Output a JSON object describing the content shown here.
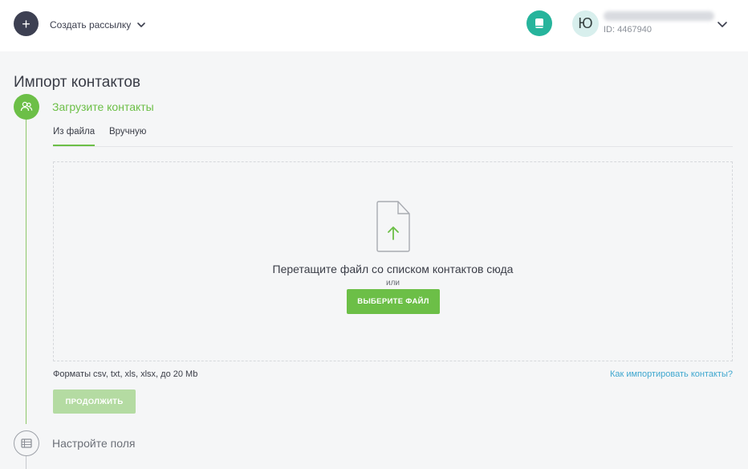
{
  "topbar": {
    "create_button_symbol": "+",
    "create_menu_label": "Создать рассылку",
    "avatar_letter": "Ю",
    "user_id": "ID: 4467940"
  },
  "page": {
    "title": "Импорт контактов"
  },
  "steps": [
    {
      "label": "Загрузите контакты",
      "state": "active",
      "icon": "users-icon"
    },
    {
      "label": "Настройте поля",
      "state": "pending",
      "icon": "table-icon"
    }
  ],
  "tabs": [
    {
      "label": "Из файла",
      "active": true
    },
    {
      "label": "Вручную",
      "active": false
    }
  ],
  "dropzone": {
    "text": "Перетащите файл со списком контактов сюда",
    "or": "или",
    "button_label": "ВЫБЕРИТЕ ФАЙЛ"
  },
  "formats_text": "Форматы csv, txt, xls, xlsx, до 20 Mb",
  "help_link": "Как импортировать контакты?",
  "continue_label": "ПРОДОЛЖИТЬ",
  "colors": {
    "accent": "#6cbf47",
    "link": "#3fa7cf",
    "help_button": "#26b49c",
    "dark_button": "#3d4052"
  }
}
